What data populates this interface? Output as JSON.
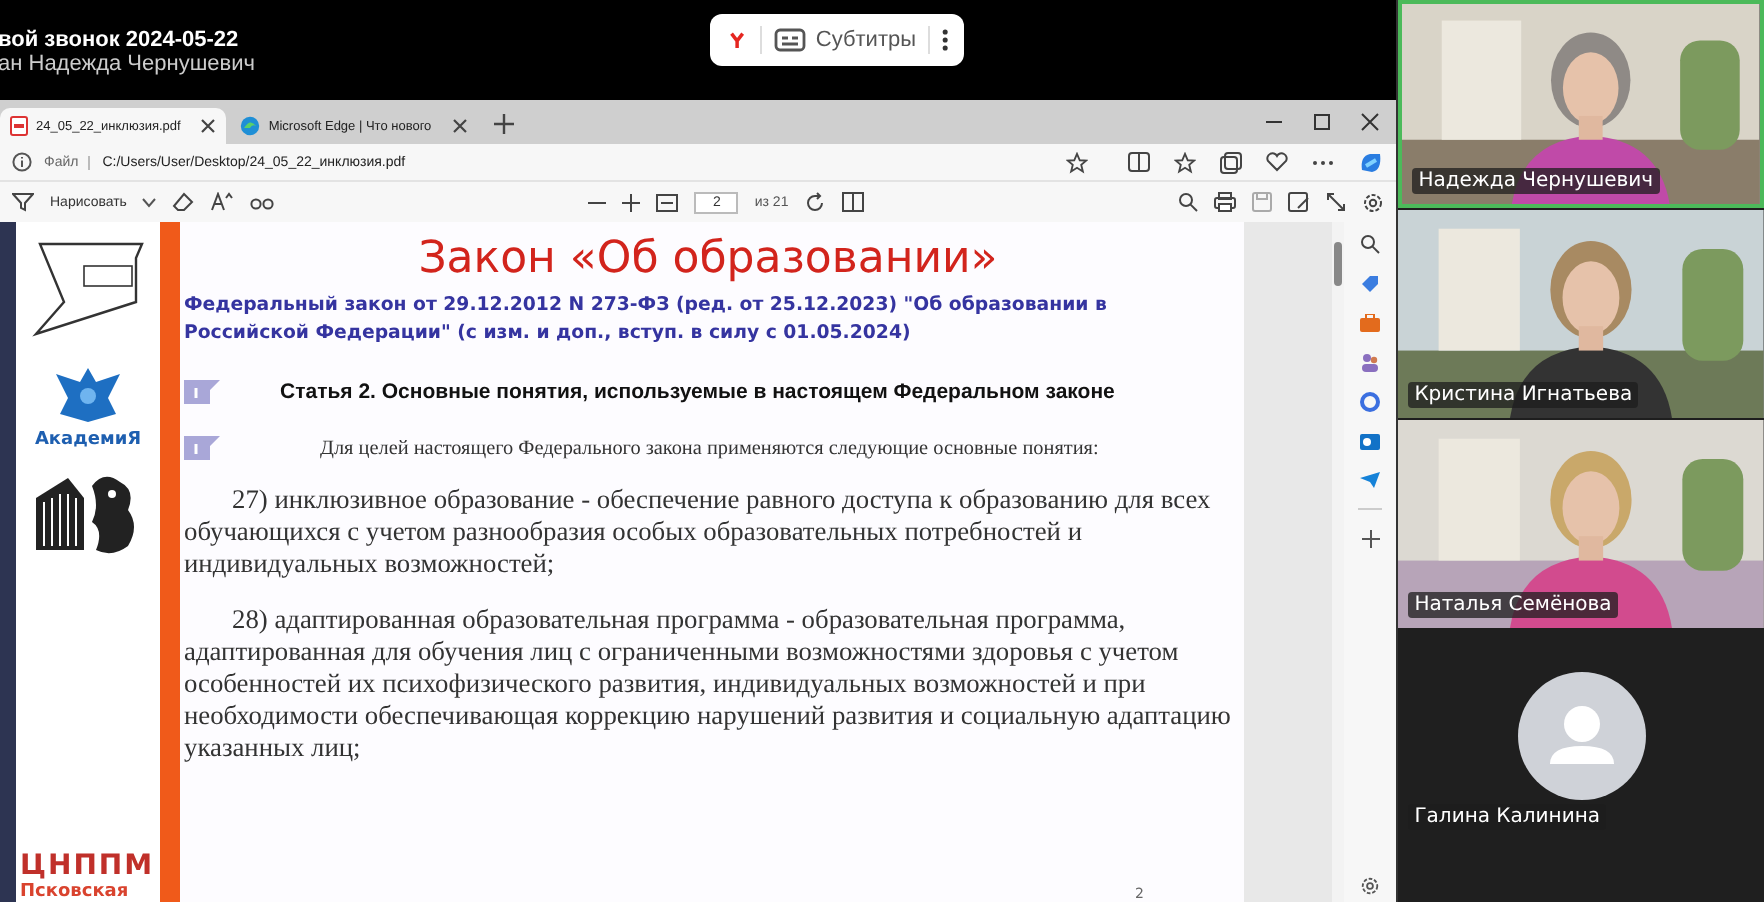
{
  "call": {
    "title": "вой звонок 2024-05-22",
    "host": "ан Надежда Чернушевич",
    "subtitles_label": "Субтитры"
  },
  "browser": {
    "tabs": [
      {
        "label": "24_05_22_инклюзия.pdf",
        "selected": true,
        "kind": "pdf"
      },
      {
        "label": "Microsoft Edge | Что нового",
        "selected": false,
        "kind": "edge"
      }
    ],
    "address_prefix": "Файл",
    "address": "C:/Users/User/Desktop/24_05_22_инклюзия.pdf",
    "draw_label": "Нарисовать",
    "page": "2",
    "page_total": "из 21"
  },
  "document": {
    "logo_academy": "АкадемиЯ",
    "logo_center": "ЦНППМ",
    "logo_region": "Псковская",
    "title": "Закон «Об образовании»",
    "source": "Федеральный закон от 29.12.2012 N 273-ФЗ (ред. от 25.12.2023) \"Об образовании в Российской Федерации\" (с изм. и доп., вступ. в силу с 01.05.2024)",
    "heading": "Статья 2. Основные понятия, используемые в настоящем Федеральном законе",
    "intro": "Для целей настоящего Федерального закона применяются следующие основные понятия:",
    "paragraphs": [
      "27) инклюзивное образование - обеспечение равного доступа к образованию для всех обучающихся с учетом разнообразия особых образовательных потребностей и индивидуальных возможностей;",
      "28) адаптированная образовательная программа - образовательная программа, адаптированная для обучения лиц с ограниченными возможностями здоровья с учетом особенностей их психофизического развития, индивидуальных возможностей и при необходимости обеспечивающая коррекцию нарушений развития и социальную адаптацию указанных лиц;"
    ],
    "page_number": "2"
  },
  "participants": [
    {
      "name": "Надежда Чернушевич",
      "kind": "video",
      "speaking": true
    },
    {
      "name": "Кристина Игнатьева",
      "kind": "video",
      "speaking": false
    },
    {
      "name": "Наталья Семёнова",
      "kind": "video",
      "speaking": false
    },
    {
      "name": "Галина Калинина",
      "kind": "avatar",
      "speaking": false
    }
  ]
}
